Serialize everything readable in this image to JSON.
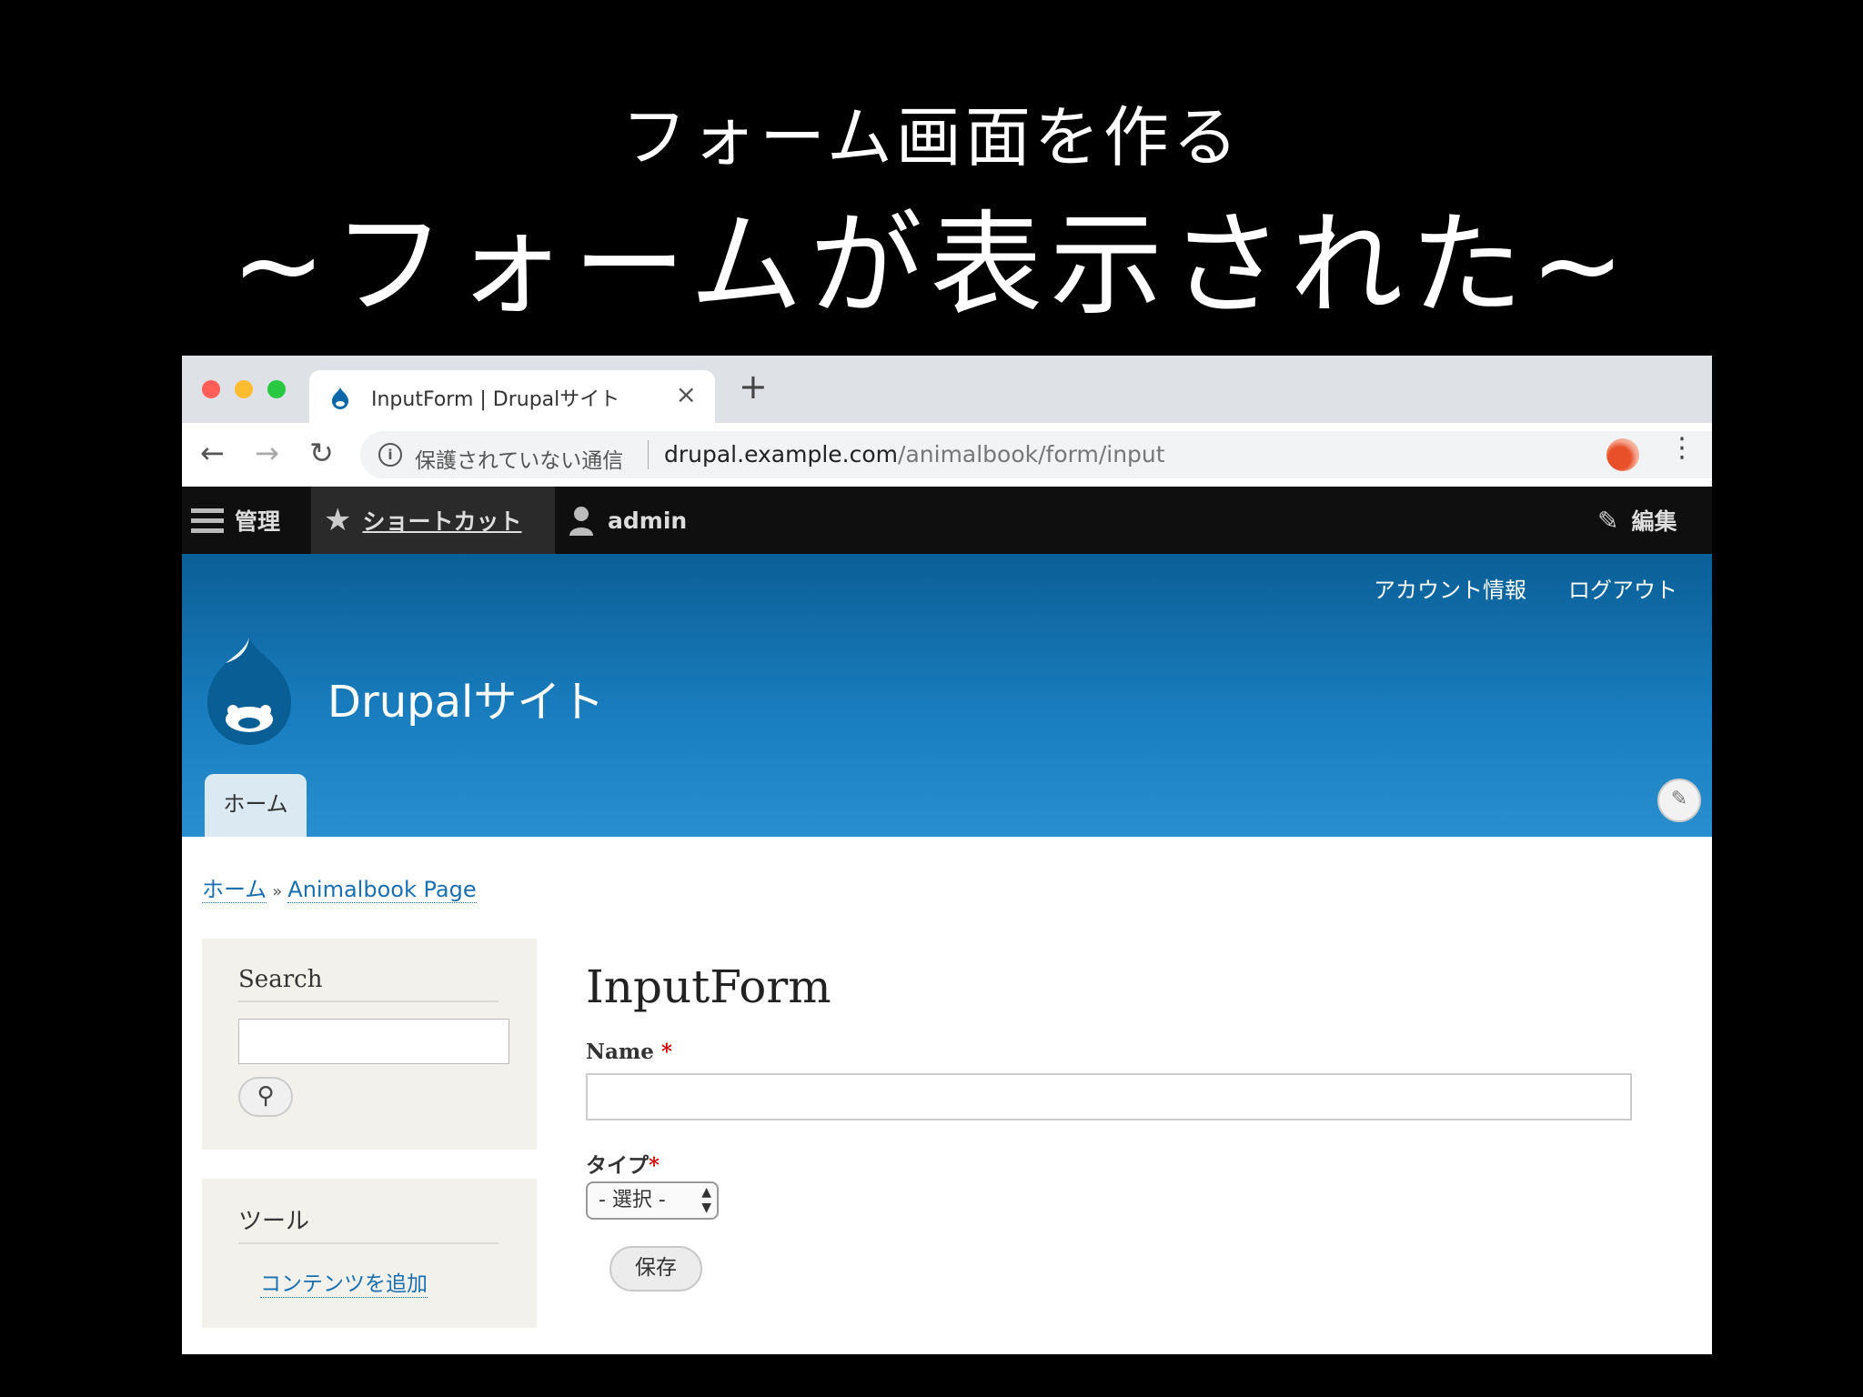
{
  "slide": {
    "title_line1": "フォーム画面を作る",
    "title_line2": "~フォームが表示された~"
  },
  "browser": {
    "tab_title": "InputForm | Drupalサイト",
    "tab_close_icon": "×",
    "new_tab_icon": "+",
    "security_text": "保護されていない通信",
    "url_host": "drupal.example.com",
    "url_path": "/animalbook/form/input"
  },
  "admin_toolbar": {
    "manage_label": "管理",
    "shortcuts_label": "ショートカット",
    "user_label": "admin",
    "edit_label": "編集"
  },
  "header": {
    "account_link": "アカウント情報",
    "logout_link": "ログアウト",
    "site_name": "Drupalサイト",
    "home_tab": "ホーム",
    "brand_color": "#1a7fc0"
  },
  "breadcrumb": {
    "home": "ホーム",
    "separator": "»",
    "current": "Animalbook Page"
  },
  "sidebar": {
    "search_title": "Search",
    "tools_title": "ツール",
    "tools_link": "コンテンツを追加"
  },
  "form": {
    "title": "InputForm",
    "name_label": "Name",
    "type_label": "タイプ",
    "required_marker": "*",
    "type_selected": "- 選択 -",
    "save_button": "保存"
  }
}
